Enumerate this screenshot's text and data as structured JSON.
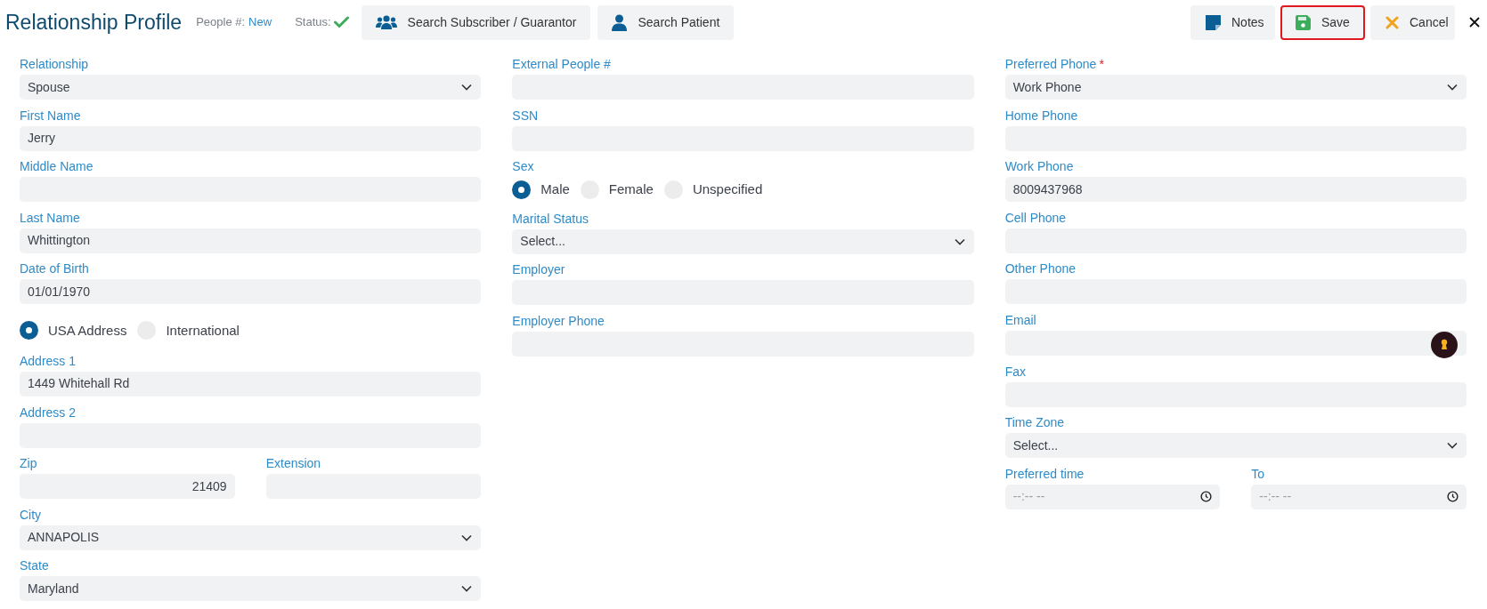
{
  "header": {
    "title": "Relationship Profile",
    "people_label": "People #:",
    "people_value": "New",
    "status_label": "Status:",
    "buttons": [
      {
        "kind": "users",
        "label": "Search Subscriber / Guarantor",
        "highlighted": false
      },
      {
        "kind": "user",
        "label": "Search Patient",
        "highlighted": false
      }
    ],
    "actions": [
      {
        "kind": "notes",
        "label": "Notes",
        "highlighted": false
      },
      {
        "kind": "save",
        "label": "Save",
        "highlighted": true
      },
      {
        "kind": "cancel",
        "label": "Cancel",
        "highlighted": false
      }
    ]
  },
  "columns": [
    [
      {
        "kind": "select",
        "label": "Relationship",
        "value": "Spouse"
      },
      {
        "kind": "text",
        "label": "First Name",
        "value": "Jerry"
      },
      {
        "kind": "text",
        "label": "Middle Name"
      },
      {
        "kind": "text",
        "label": "Last Name",
        "value": "Whittington"
      },
      {
        "kind": "text",
        "label": "Date of Birth",
        "value": "01/01/1970"
      },
      {
        "kind": "radio",
        "options": [
          {
            "label": "USA Address",
            "selected": true
          },
          {
            "label": "International",
            "selected": false
          }
        ]
      },
      {
        "kind": "text",
        "label": "Address 1",
        "value": "1449 Whitehall Rd"
      },
      {
        "kind": "text",
        "label": "Address 2"
      },
      {
        "kind": "pair",
        "fields": [
          {
            "kind": "number",
            "label": "Zip",
            "value": "21409"
          },
          {
            "kind": "text",
            "label": "Extension"
          }
        ]
      },
      {
        "kind": "select",
        "label": "City",
        "value": "ANNAPOLIS"
      },
      {
        "kind": "select",
        "label": "State",
        "value": "Maryland"
      }
    ],
    [
      {
        "kind": "text",
        "label": "External People #"
      },
      {
        "kind": "text",
        "label": "SSN"
      },
      {
        "kind": "radio",
        "label": "Sex",
        "options": [
          {
            "label": "Male",
            "selected": true
          },
          {
            "label": "Female",
            "selected": false
          },
          {
            "label": "Unspecified",
            "selected": false
          }
        ]
      },
      {
        "kind": "select",
        "label": "Marital Status",
        "value": "Select..."
      },
      {
        "kind": "text",
        "label": "Employer"
      },
      {
        "kind": "text",
        "label": "Employer Phone"
      }
    ],
    [
      {
        "kind": "select",
        "label": "Preferred Phone",
        "required_mark": "*",
        "value": "Work Phone"
      },
      {
        "kind": "text",
        "label": "Home Phone"
      },
      {
        "kind": "text",
        "label": "Work Phone",
        "value": "8009437968"
      },
      {
        "kind": "text",
        "label": "Cell Phone"
      },
      {
        "kind": "text",
        "label": "Other Phone"
      },
      {
        "kind": "email",
        "label": "Email"
      },
      {
        "kind": "text",
        "label": "Fax"
      },
      {
        "kind": "select",
        "label": "Time Zone",
        "value": "Select..."
      },
      {
        "kind": "pair",
        "fields": [
          {
            "kind": "time",
            "label": "Preferred time",
            "placeholder": "--:-- --"
          },
          {
            "kind": "time",
            "label": "To",
            "placeholder": "--:-- --"
          }
        ]
      }
    ]
  ]
}
